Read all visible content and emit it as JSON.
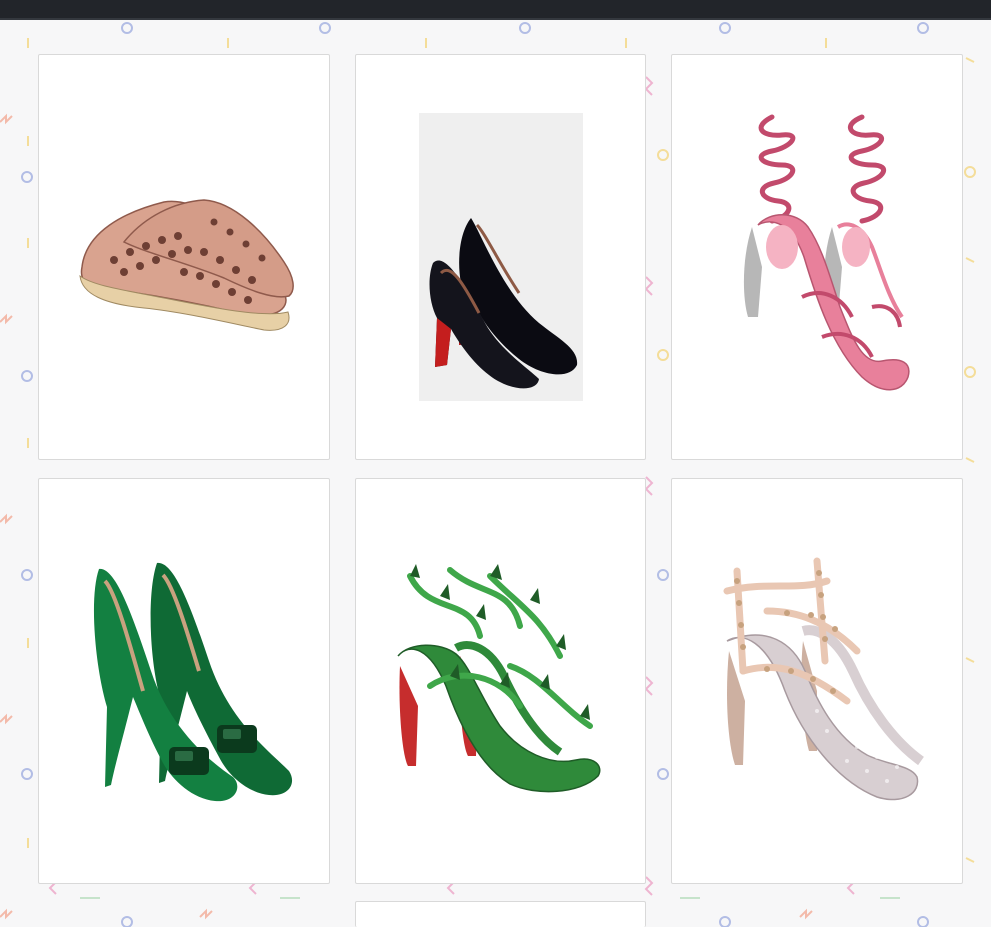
{
  "colors": {
    "page_background": "#f7f7f8",
    "top_bar": "#22252a",
    "card_background": "#ffffff",
    "card_border": "#d9d9d9",
    "pattern_accents": [
      "#7b8fd6",
      "#f2c94c",
      "#f08a6b",
      "#e77fb0",
      "#9fd3a8"
    ]
  },
  "products": [
    {
      "item": "espadrille",
      "image_icon": "perforated-espadrille-icon",
      "colors": [
        "#d9a38f",
        "#e7d0a6"
      ]
    },
    {
      "item": "pump",
      "image_icon": "patent-pump-icon",
      "colors": [
        "#0b0b12",
        "#c41e1e"
      ]
    },
    {
      "item": "sandal",
      "image_icon": "coil-sandal-icon",
      "colors": [
        "#e8809b",
        "#b7b7b7"
      ]
    },
    {
      "item": "pump",
      "image_icon": "suede-bow-pump-icon",
      "colors": [
        "#0f6a35",
        "#0b3a1d"
      ]
    },
    {
      "item": "sandal",
      "image_icon": "spiked-strappy-sandal-icon",
      "colors": [
        "#2f8a3a",
        "#c62d2d"
      ]
    },
    {
      "item": "pump",
      "image_icon": "studded-slingback-pump-icon",
      "colors": [
        "#e9c7b3",
        "#d8cfd2"
      ]
    },
    {
      "item": "card",
      "image_icon": "partial-product-card-icon",
      "colors": []
    }
  ]
}
